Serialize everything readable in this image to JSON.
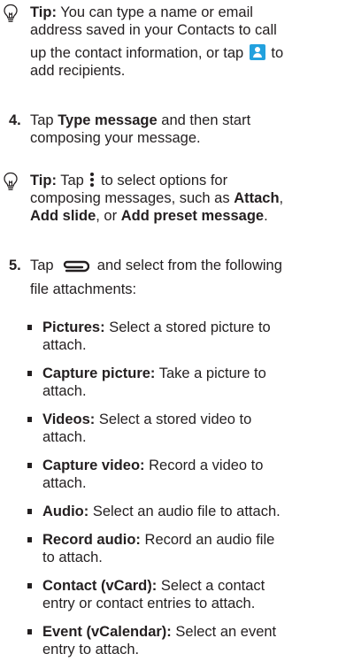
{
  "tip1": {
    "label": "Tip:",
    "line1": " You can type a name or email",
    "line2": "address saved in your Contacts to call",
    "line3": "up the contact information, or tap",
    "line3_after": " to",
    "line4": "add recipients."
  },
  "step4": {
    "number": "4.",
    "before": "Tap ",
    "bold": "Type message",
    "after": " and then start",
    "line2": "composing your message."
  },
  "tip2": {
    "label": "Tip:",
    "before": " Tap ",
    "after": " to select options for",
    "line2": "composing messages, such as ",
    "opt1": "Attach",
    "sep1": ",",
    "opt2": "Add slide",
    "sep2": ", or ",
    "opt3": "Add preset message",
    "end": "."
  },
  "step5": {
    "number": "5.",
    "before": "Tap ",
    "after": " and select from the following",
    "line2": "file attachments:"
  },
  "attachments": [
    {
      "label": "Pictures:",
      "l1": " Select a stored picture to",
      "l2": "attach."
    },
    {
      "label": "Capture picture:",
      "l1": " Take a picture to",
      "l2": "attach."
    },
    {
      "label": "Videos:",
      "l1": " Select a stored video to",
      "l2": "attach."
    },
    {
      "label": "Capture video:",
      "l1": " Record a video to",
      "l2": "attach."
    },
    {
      "label": "Audio:",
      "l1": " Select an audio file to attach.",
      "l2": ""
    },
    {
      "label": "Record audio:",
      "l1": " Record an audio file",
      "l2": "to attach."
    },
    {
      "label": "Contact (vCard):",
      "l1": " Select a contact",
      "l2": "entry or contact entries to attach."
    },
    {
      "label": "Event (vCalendar):",
      "l1": " Select an event",
      "l2": "entry to attach."
    }
  ],
  "icons": {
    "tip": "lightbulb-icon",
    "contacts": "contacts-icon",
    "menu": "more-options-icon",
    "attach": "paperclip-icon"
  },
  "colors": {
    "text": "#231f20",
    "contact_icon": "#22a1de"
  }
}
